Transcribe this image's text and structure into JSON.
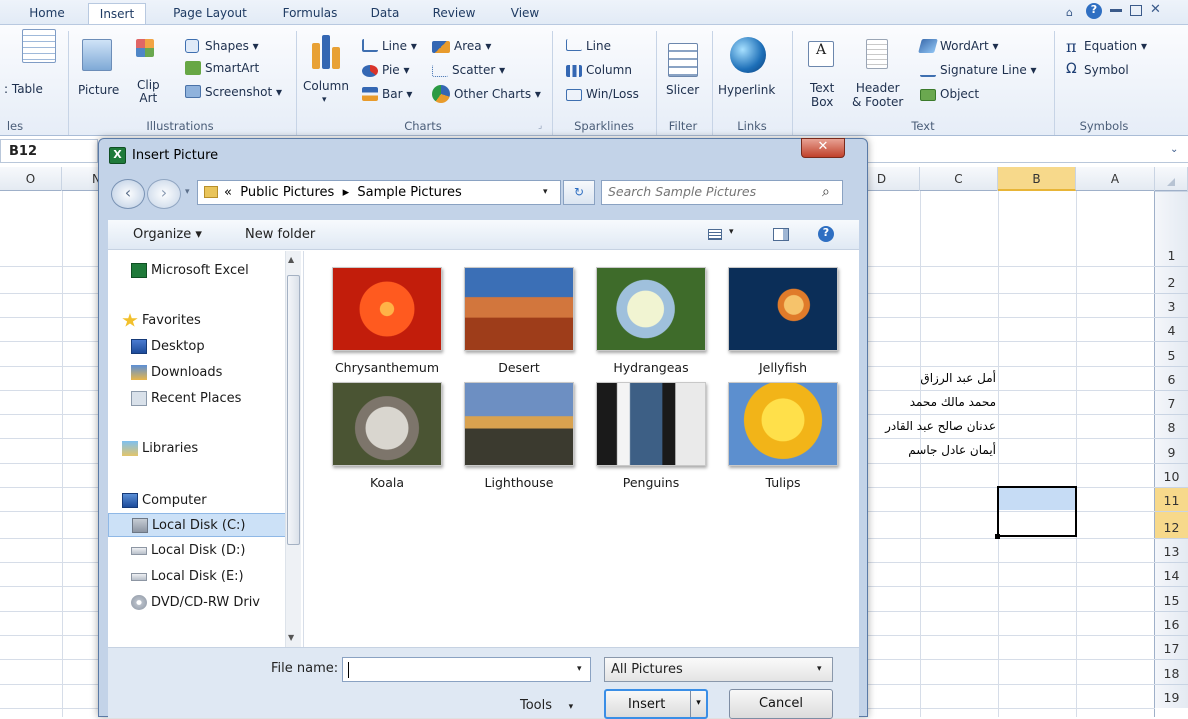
{
  "ribbon": {
    "tabs": [
      "Home",
      "Insert",
      "Page Layout",
      "Formulas",
      "Data",
      "Review",
      "View"
    ],
    "groups": {
      "tables": {
        "label": "les",
        "table": "Table"
      },
      "illustrations": {
        "label": "Illustrations",
        "picture": "Picture",
        "clipart": "Clip\nArt",
        "shapes": "Shapes ▾",
        "smartart": "SmartArt",
        "screenshot": "Screenshot ▾"
      },
      "charts": {
        "label": "Charts",
        "column": "Column",
        "line": "Line ▾",
        "area": "Area ▾",
        "pie": "Pie ▾",
        "scatter": "Scatter ▾",
        "bar": "Bar ▾",
        "other": "Other Charts ▾"
      },
      "sparklines": {
        "label": "Sparklines",
        "line": "Line",
        "column": "Column",
        "winloss": "Win/Loss"
      },
      "filter": {
        "label": "Filter",
        "slicer": "Slicer"
      },
      "links": {
        "label": "Links",
        "hyperlink": "Hyperlink"
      },
      "text": {
        "label": "Text",
        "textbox1": "Text",
        "textbox2": "Box",
        "header1": "Header",
        "header2": "& Footer",
        "wordart": "WordArt ▾",
        "signature": "Signature Line ▾",
        "object": "Object"
      },
      "symbols": {
        "label": "Symbols",
        "equation": "Equation ▾",
        "symbol": "Symbol"
      }
    }
  },
  "sheet": {
    "namebox": "B12",
    "columns_left": [
      "O",
      "N"
    ],
    "columns_right": [
      "D",
      "C",
      "B",
      "A"
    ],
    "rows": [
      "1",
      "2",
      "3",
      "4",
      "5",
      "6",
      "7",
      "8",
      "9",
      "10",
      "11",
      "12",
      "13",
      "14",
      "15",
      "16",
      "17",
      "18",
      "19"
    ],
    "cells": [
      "أمل عبد الرزاق",
      "محمد مالك محمد",
      "عدنان صالح عبد القادر",
      "أيمان عادل جاسم"
    ]
  },
  "dialog": {
    "title": "Insert Picture",
    "breadcrumb": {
      "prefix": "«",
      "part1": "Public Pictures",
      "sep": "▸",
      "part2": "Sample Pictures"
    },
    "search_placeholder": "Search Sample Pictures",
    "organize": "Organize ▾",
    "newfolder": "New folder",
    "nav": [
      "Microsoft Excel",
      "Favorites",
      "Desktop",
      "Downloads",
      "Recent Places",
      "Libraries",
      "Computer",
      "Local Disk (C:)",
      "Local Disk (D:)",
      "Local Disk (E:)",
      "DVD/CD-RW Driv"
    ],
    "files": [
      "Chrysanthemum",
      "Desert",
      "Hydrangeas",
      "Jellyfish",
      "Koala",
      "Lighthouse",
      "Penguins",
      "Tulips"
    ],
    "filename_label": "File name:",
    "filename_value": "",
    "filetype": "All Pictures",
    "tools": "Tools",
    "insert": "Insert",
    "cancel": "Cancel"
  }
}
